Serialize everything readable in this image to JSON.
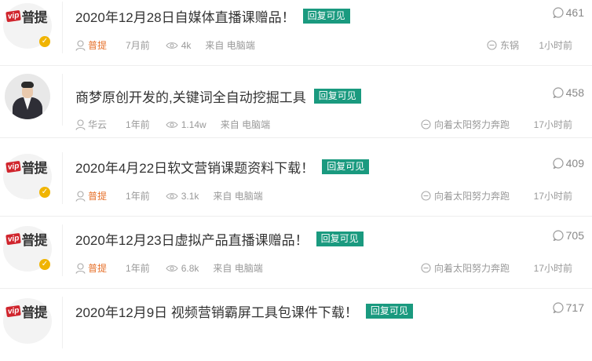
{
  "threads": [
    {
      "avatar": "vip-logo",
      "logo_vip": "vip",
      "logo_text": "普提",
      "title": "2020年12月28日自媒体直播课赠品！",
      "tag": "回复可见",
      "replies": "461",
      "author": "普提",
      "author_style": "highlight",
      "time": "7月前",
      "views": "4k",
      "source": "来自 电脑端",
      "last_reply_user": "东锅",
      "last_reply_time": "1小时前"
    },
    {
      "avatar": "photo",
      "title": "商梦原创开发的,关键词全自动挖掘工具",
      "tag": "回复可见",
      "replies": "458",
      "author": "华云",
      "author_style": "plain",
      "time": "1年前",
      "views": "1.14w",
      "source": "来自 电脑端",
      "last_reply_user": "向着太阳努力奔跑",
      "last_reply_time": "17小时前"
    },
    {
      "avatar": "vip-logo",
      "logo_vip": "vip",
      "logo_text": "普提",
      "title": "2020年4月22日软文营销课题资料下载！",
      "tag": "回复可见",
      "replies": "409",
      "author": "普提",
      "author_style": "highlight",
      "time": "1年前",
      "views": "3.1k",
      "source": "来自 电脑端",
      "last_reply_user": "向着太阳努力奔跑",
      "last_reply_time": "17小时前"
    },
    {
      "avatar": "vip-logo",
      "logo_vip": "vip",
      "logo_text": "普提",
      "title": "2020年12月23日虚拟产品直播课赠品！",
      "tag": "回复可见",
      "replies": "705",
      "author": "普提",
      "author_style": "highlight",
      "time": "1年前",
      "views": "6.8k",
      "source": "来自 电脑端",
      "last_reply_user": "向着太阳努力奔跑",
      "last_reply_time": "17小时前"
    },
    {
      "avatar": "vip-logo",
      "logo_vip": "vip",
      "logo_text": "普提",
      "title": "2020年12月9日 视频营销霸屏工具包课件下载！",
      "tag": "回复可见",
      "replies": "717",
      "author": "",
      "author_style": "highlight",
      "time": "",
      "views": "",
      "source": "",
      "last_reply_user": "",
      "last_reply_time": ""
    }
  ],
  "colors": {
    "tag_bg": "#1a9a7f",
    "author_highlight": "#e6712b",
    "vip_red": "#d0252d",
    "verified_gold": "#f0b400"
  },
  "icons": {
    "replies": "speech-bubble-icon",
    "author": "user-icon",
    "views": "eye-icon",
    "last_reply": "minus-circle-icon",
    "verified": "v-badge-icon"
  }
}
